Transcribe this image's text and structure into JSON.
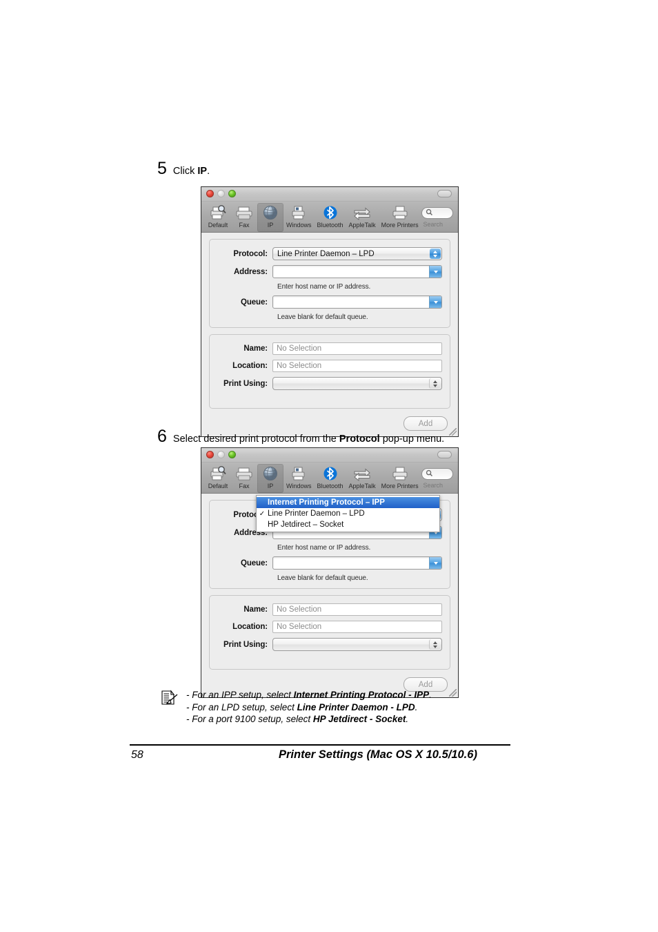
{
  "steps": [
    {
      "number": "5",
      "text_before": "Click ",
      "bold": "IP",
      "text_after": "."
    },
    {
      "number": "6",
      "text_before": "Select desired print protocol from the ",
      "bold": "Protocol",
      "text_after": " pop-up menu."
    }
  ],
  "window": {
    "toolbar": {
      "items": [
        {
          "label": "Default",
          "icon": "printer-magnifier-icon",
          "selected": false
        },
        {
          "label": "Fax",
          "icon": "fax-machine-icon",
          "selected": false
        },
        {
          "label": "IP",
          "icon": "globe-icon",
          "selected": true
        },
        {
          "label": "Windows",
          "icon": "printer-windows-icon",
          "selected": false
        },
        {
          "label": "Bluetooth",
          "icon": "bluetooth-icon",
          "selected": false
        },
        {
          "label": "AppleTalk",
          "icon": "appletalk-arrows-icon",
          "selected": false
        },
        {
          "label": "More Printers",
          "icon": "printer-icon",
          "selected": false
        }
      ],
      "search_placeholder": "Search"
    },
    "form": {
      "protocol_label": "Protocol:",
      "protocol_value": "Line Printer Daemon – LPD",
      "address_label": "Address:",
      "address_value": "",
      "address_helper": "Enter host name or IP address.",
      "queue_label": "Queue:",
      "queue_value": "",
      "queue_helper": "Leave blank for default queue.",
      "name_label": "Name:",
      "name_value": "No Selection",
      "location_label": "Location:",
      "location_value": "No Selection",
      "print_using_label": "Print Using:",
      "print_using_value": ""
    },
    "add_button": "Add"
  },
  "protocol_menu": {
    "items": [
      {
        "label": "Internet Printing Protocol – IPP",
        "checked": false,
        "highlighted": true
      },
      {
        "label": "Line Printer Daemon – LPD",
        "checked": true,
        "highlighted": false
      },
      {
        "label": "HP Jetdirect – Socket",
        "checked": false,
        "highlighted": false
      }
    ],
    "check_glyph": "✓"
  },
  "note": {
    "icon": "note-document-pen-icon",
    "lines": [
      {
        "prefix": "- For an IPP setup, select ",
        "bold": "Internet Printing Protocol - IPP",
        "suffix": "."
      },
      {
        "prefix": "- For an LPD setup, select ",
        "bold": "Line Printer Daemon - LPD",
        "suffix": "."
      },
      {
        "prefix": "- For a port 9100 setup, select ",
        "bold": "HP Jetdirect - Socket",
        "suffix": "."
      }
    ]
  },
  "footer": {
    "page_number": "58",
    "title": "Printer Settings (Mac OS X 10.5/10.6)"
  },
  "colors": {
    "accent_blue": "#2f86d2",
    "menu_highlight": "#2060c8",
    "bluetooth_blue": "#0a74d8",
    "window_bg": "#ededed",
    "toolbar_bg": "#a9a9a9"
  }
}
